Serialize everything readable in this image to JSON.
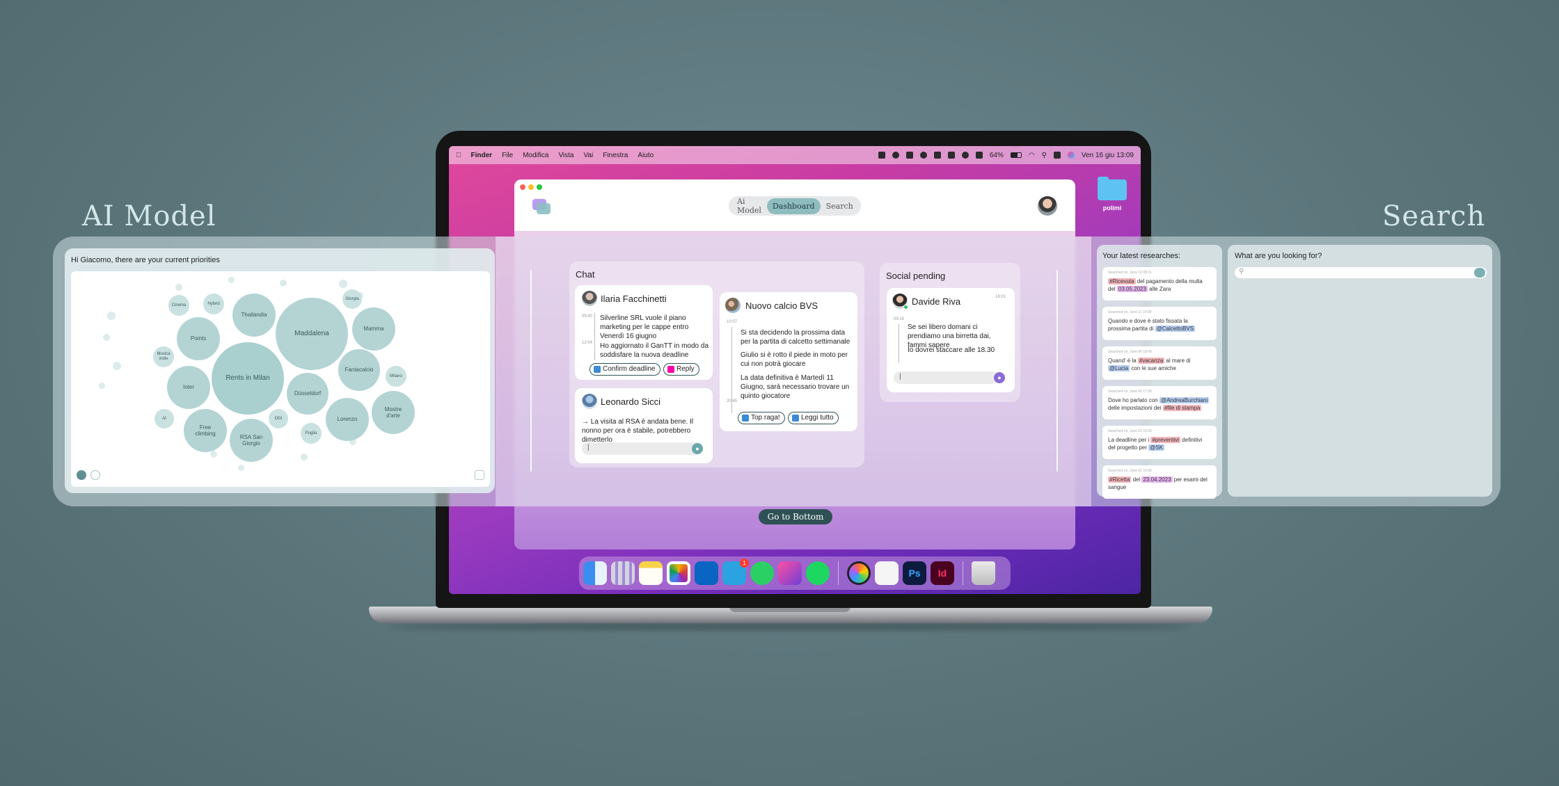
{
  "titles": {
    "ai_model": "AI Model",
    "search": "Search"
  },
  "menubar": {
    "apple": "",
    "items": [
      "Finder",
      "File",
      "Modifica",
      "Vista",
      "Vai",
      "Finestra",
      "Aiuto"
    ],
    "battery": "64%",
    "datetime": "Ven 16 giu  13:09"
  },
  "desktop": {
    "folder_label": "polimi"
  },
  "app": {
    "tabs": [
      "Ai Model",
      "Dashboard",
      "Search"
    ],
    "active_tab": "Dashboard",
    "go_bottom": "Go to Bottom"
  },
  "ai_panel": {
    "greeting": "Hi Giacomo, there are your current priorities",
    "bubbles": [
      "Rents in Milan",
      "Maddalena",
      "Thailandia",
      "Points",
      "Inter",
      "Free climbing",
      "RSA San Giorgio",
      "Düsseldorf",
      "Fantacalcio",
      "Mamma",
      "Lorenzo",
      "Mostre d'arte",
      "Milano",
      "Giorgia",
      "Cinema",
      "Hybrid",
      "Musica indie",
      "AI",
      "OGI",
      "Puglia"
    ]
  },
  "chat": {
    "heading": "Chat",
    "threads": [
      {
        "name": "Ilaria Facchinetti",
        "messages": [
          {
            "time": "09:40",
            "text": "Silverline SRL vuole il piano marketing per le cappe entro Venerdì 16 giugno"
          },
          {
            "time": "12:04",
            "text": "Ho aggiornato il GanTT in modo da soddisfare la nuova deadline"
          }
        ],
        "actions": [
          "Confirm deadline",
          "Reply"
        ]
      },
      {
        "name": "Leonardo Sicci",
        "messages": [
          {
            "text": "→ La visita al RSA è andata bene. Il nonno per ora è stabile, potrebbero dimetterlo"
          }
        ],
        "input_placeholder": "|"
      },
      {
        "name": "Nuovo calcio BVS",
        "messages": [
          {
            "time": "10:07",
            "text": "Si sta decidendo la prossima data per la partita di calcetto settimanale"
          },
          {
            "text": "Giulio si è rotto il piede in moto per cui non potrà giocare"
          },
          {
            "time": "20:45",
            "text": "La data definitiva è Martedì 11 Giugno, sarà necessario trovare un quinto giocatore"
          }
        ],
        "actions": [
          "Top raga!",
          "Leggi tutto"
        ]
      }
    ]
  },
  "social": {
    "heading": "Social pending",
    "name": "Davide Riva",
    "time": "18:01",
    "messages": [
      {
        "time": "09:16",
        "text": "Se sei libero domani ci prendiamo una birretta dai, fammi sapere"
      },
      {
        "text": "Io dovrei staccare alle 18.30"
      }
    ],
    "input_placeholder": "|"
  },
  "latest": {
    "title": "Your latest researches:",
    "items": [
      {
        "ts": "Searched on, June 13 08:21",
        "parts": [
          [
            "red",
            "#Ricevuta"
          ],
          [
            "",
            " del pagamento della multa del "
          ],
          [
            "pink",
            "03.05.2023"
          ],
          [
            "",
            " alle Zara"
          ]
        ]
      },
      {
        "ts": "Searched on, June 11 14:09",
        "parts": [
          [
            "",
            "Quando e dove è stato fissata la prossima partita di "
          ],
          [
            "blue",
            "@CalcettoBVS"
          ]
        ]
      },
      {
        "ts": "Searched on, June 06 18:43",
        "parts": [
          [
            "",
            "Quand' è la "
          ],
          [
            "red",
            "#vacanza"
          ],
          [
            "",
            " al mare di "
          ],
          [
            "blue",
            "@Lucia"
          ],
          [
            "",
            " con le sue amiche"
          ]
        ]
      },
      {
        "ts": "Searched on, June 06 17:30",
        "parts": [
          [
            "",
            "Dove ho parlato con "
          ],
          [
            "blue",
            "@AndreaBurchiani"
          ],
          [
            "",
            " delle impostazioni dei "
          ],
          [
            "red",
            "#file di stampa"
          ]
        ]
      },
      {
        "ts": "Searched on, June 03 15:26",
        "parts": [
          [
            "",
            "La deadline per i "
          ],
          [
            "red",
            "#preventivi"
          ],
          [
            "",
            " definitivi del progetto per "
          ],
          [
            "blue",
            "@SK"
          ]
        ]
      },
      {
        "ts": "Searched on, June 02 10:06",
        "parts": [
          [
            "red",
            "#Ricetta"
          ],
          [
            "",
            " del "
          ],
          [
            "pink",
            "23.04.2023"
          ],
          [
            "",
            " per esami del sangue"
          ]
        ]
      }
    ]
  },
  "search": {
    "question": "What are you looking for?",
    "placeholder": ""
  },
  "dock": {
    "apps": [
      "finder-icon",
      "launchpad-icon",
      "notes-icon",
      "photos-icon",
      "outlook-icon",
      "telegram-icon",
      "whatsapp-icon",
      "affinity-icon",
      "spotify-icon",
      "arc-icon",
      "figma-icon",
      "photoshop-icon",
      "indesign-icon",
      "trash-icon"
    ],
    "telegram_badge": "1",
    "ps_label": "Ps",
    "id_label": "Id"
  },
  "colors": {
    "accent": "#8fbcbf",
    "dark_teal": "#2f5155",
    "mic_teal": "#6aa7a9",
    "mic_purple": "#8a6ad6"
  }
}
